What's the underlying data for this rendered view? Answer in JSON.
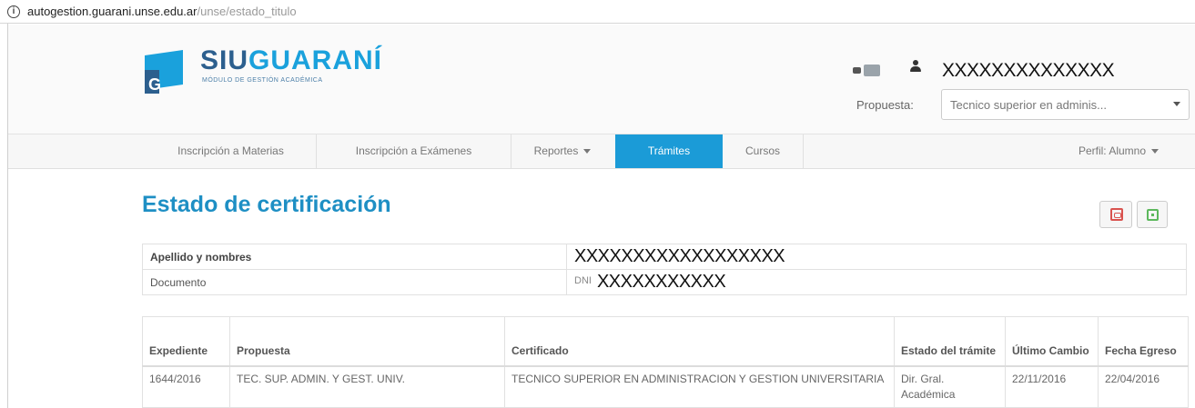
{
  "browser": {
    "url_domain": "autogestion.guarani.unse.edu.ar",
    "url_path": "/unse/estado_titulo"
  },
  "header": {
    "logo_siu": "SIU",
    "logo_guarani": "GUARANÍ",
    "logo_subtitle": "MÓDULO DE GESTIÓN ACADÉMICA",
    "username": "XXXXXXXXXXXXXX",
    "propuesta_label": "Propuesta:",
    "propuesta_value": "Tecnico superior en adminis..."
  },
  "nav": {
    "items": [
      {
        "label": "Inscripción a Materias"
      },
      {
        "label": "Inscripción a Exámenes"
      },
      {
        "label": "Reportes"
      },
      {
        "label": "Trámites"
      },
      {
        "label": "Cursos"
      }
    ],
    "active_index": 3,
    "perfil": "Perfil: Alumno"
  },
  "page": {
    "title": "Estado de certificación"
  },
  "person": {
    "name_label": "Apellido y nombres",
    "name_value": "XXXXXXXXXXXXXXXXXX",
    "doc_label": "Documento",
    "doc_prefix": "DNI",
    "doc_value": "XXXXXXXXXXX"
  },
  "certificates": {
    "headers": [
      "Expediente",
      "Propuesta",
      "Certificado",
      "Estado del trámite",
      "Último Cambio",
      "Fecha Egreso"
    ],
    "rows": [
      {
        "expediente": "1644/2016",
        "propuesta": "TEC. SUP. ADMIN. Y GEST. UNIV.",
        "certificado": "TECNICO SUPERIOR EN ADMINISTRACION Y GESTION UNIVERSITARIA",
        "estado": "Dir. Gral. Académica",
        "ultimo_cambio": "22/11/2016",
        "fecha_egreso": "22/04/2016"
      }
    ]
  },
  "colors": {
    "accent": "#1b9bd7",
    "title": "#1e8fc4",
    "logo_dark": "#2c5f8e"
  }
}
